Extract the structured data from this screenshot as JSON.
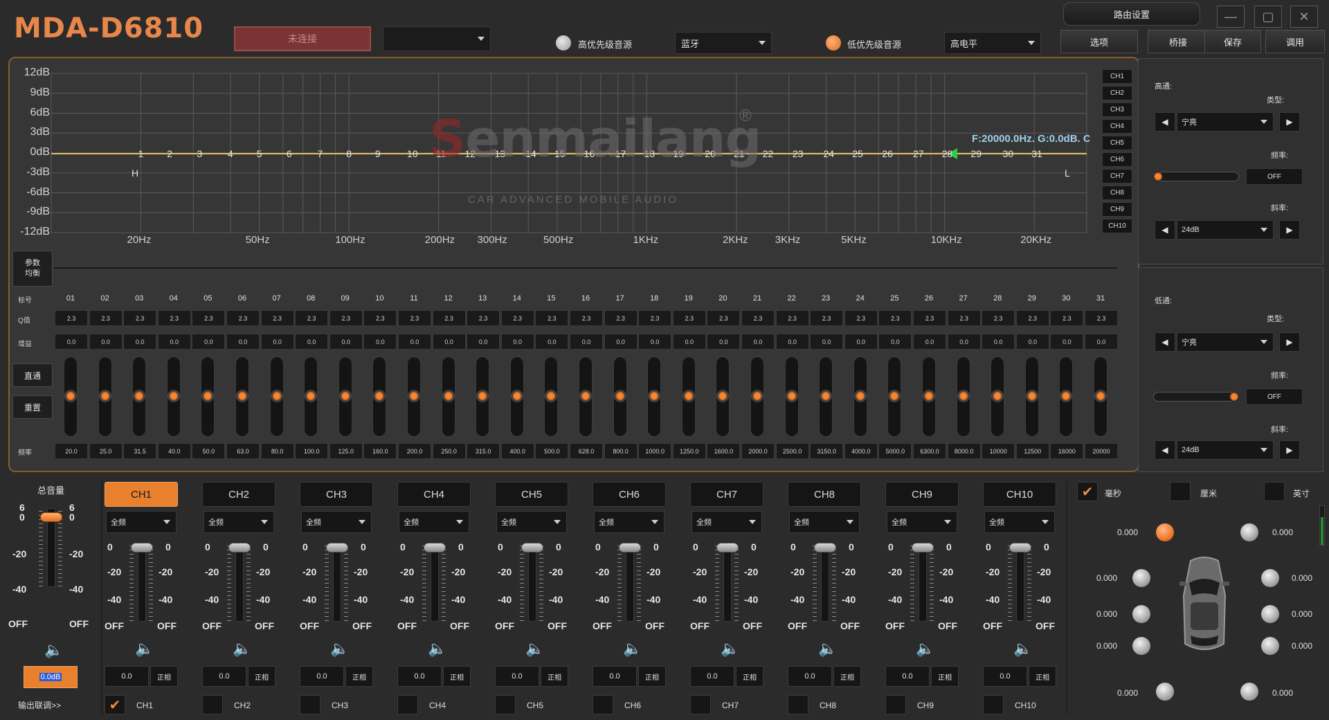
{
  "header": {
    "logo": "MDA-D6810",
    "connect_label": "未连接",
    "device_select": "",
    "high_priority_label": "高优先级音源",
    "high_priority_source": "蓝牙",
    "low_priority_label": "低优先级音源",
    "low_priority_source": "高电平",
    "routing_label": "路由设置",
    "buttons": [
      "选项",
      "桥接",
      "保存",
      "调用"
    ],
    "window_controls": {
      "minimize": "—",
      "maximize": "▢",
      "close": "✕"
    }
  },
  "eq": {
    "y_ticks": [
      "12dB",
      "9dB",
      "6dB",
      "3dB",
      "0dB",
      "-3dB",
      "-6dB",
      "-9dB",
      "-12dB"
    ],
    "x_ticks": [
      "20Hz",
      "50Hz",
      "100Hz",
      "200Hz",
      "300Hz",
      "500Hz",
      "1KHz",
      "2KHz",
      "3KHz",
      "5KHz",
      "10KHz",
      "20KHz"
    ],
    "band_markers": [
      "1",
      "2",
      "3",
      "4",
      "5",
      "6",
      "7",
      "8",
      "9",
      "10",
      "11",
      "12",
      "13",
      "14",
      "15",
      "16",
      "17",
      "18",
      "19",
      "20",
      "21",
      "22",
      "23",
      "24",
      "25",
      "26",
      "27",
      "28",
      "29",
      "30",
      "31"
    ],
    "hp_marker": "H",
    "lp_marker": "L",
    "readout": "F:20000.0Hz. G:0.0dB. C",
    "watermark": {
      "brand": "enmailang",
      "brand_s": "S",
      "tagline": "CAR ADVANCED MOBILE AUDIO",
      "reg": "®"
    },
    "channel_tabs": [
      "CH1",
      "CH2",
      "CH3",
      "CH4",
      "CH5",
      "CH6",
      "CH7",
      "CH8",
      "CH9",
      "CH10"
    ],
    "peq_label_1": "参数",
    "peq_label_2": "均衡",
    "row_labels": {
      "band": "标号",
      "q": "Q值",
      "gain": "增益",
      "freq": "频率"
    },
    "bypass_label": "直通",
    "reset_label": "重置",
    "bands": [
      {
        "no": "01",
        "q": "2.3",
        "gain": "0.0",
        "freq": "20.0"
      },
      {
        "no": "02",
        "q": "2.3",
        "gain": "0.0",
        "freq": "25.0"
      },
      {
        "no": "03",
        "q": "2.3",
        "gain": "0.0",
        "freq": "31.5"
      },
      {
        "no": "04",
        "q": "2.3",
        "gain": "0.0",
        "freq": "40.0"
      },
      {
        "no": "05",
        "q": "2.3",
        "gain": "0.0",
        "freq": "50.0"
      },
      {
        "no": "06",
        "q": "2.3",
        "gain": "0.0",
        "freq": "63.0"
      },
      {
        "no": "07",
        "q": "2.3",
        "gain": "0.0",
        "freq": "80.0"
      },
      {
        "no": "08",
        "q": "2.3",
        "gain": "0.0",
        "freq": "100.0"
      },
      {
        "no": "09",
        "q": "2.3",
        "gain": "0.0",
        "freq": "125.0"
      },
      {
        "no": "10",
        "q": "2.3",
        "gain": "0.0",
        "freq": "160.0"
      },
      {
        "no": "11",
        "q": "2.3",
        "gain": "0.0",
        "freq": "200.0"
      },
      {
        "no": "12",
        "q": "2.3",
        "gain": "0.0",
        "freq": "250.0"
      },
      {
        "no": "13",
        "q": "2.3",
        "gain": "0.0",
        "freq": "315.0"
      },
      {
        "no": "14",
        "q": "2.3",
        "gain": "0.0",
        "freq": "400.0"
      },
      {
        "no": "15",
        "q": "2.3",
        "gain": "0.0",
        "freq": "500.0"
      },
      {
        "no": "16",
        "q": "2.3",
        "gain": "0.0",
        "freq": "628.0"
      },
      {
        "no": "17",
        "q": "2.3",
        "gain": "0.0",
        "freq": "800.0"
      },
      {
        "no": "18",
        "q": "2.3",
        "gain": "0.0",
        "freq": "1000.0"
      },
      {
        "no": "19",
        "q": "2.3",
        "gain": "0.0",
        "freq": "1250.0"
      },
      {
        "no": "20",
        "q": "2.3",
        "gain": "0.0",
        "freq": "1600.0"
      },
      {
        "no": "21",
        "q": "2.3",
        "gain": "0.0",
        "freq": "2000.0"
      },
      {
        "no": "22",
        "q": "2.3",
        "gain": "0.0",
        "freq": "2500.0"
      },
      {
        "no": "23",
        "q": "2.3",
        "gain": "0.0",
        "freq": "3150.0"
      },
      {
        "no": "24",
        "q": "2.3",
        "gain": "0.0",
        "freq": "4000.0"
      },
      {
        "no": "25",
        "q": "2.3",
        "gain": "0.0",
        "freq": "5000.0"
      },
      {
        "no": "26",
        "q": "2.3",
        "gain": "0.0",
        "freq": "6300.0"
      },
      {
        "no": "27",
        "q": "2.3",
        "gain": "0.0",
        "freq": "8000.0"
      },
      {
        "no": "28",
        "q": "2.3",
        "gain": "0.0",
        "freq": "10000"
      },
      {
        "no": "29",
        "q": "2.3",
        "gain": "0.0",
        "freq": "12500"
      },
      {
        "no": "30",
        "q": "2.3",
        "gain": "0.0",
        "freq": "16000"
      },
      {
        "no": "31",
        "q": "2.3",
        "gain": "0.0",
        "freq": "20000"
      }
    ]
  },
  "highpass": {
    "title": "高通:",
    "type_label": "类型:",
    "type": "宁亮",
    "freq_label": "频率:",
    "freq": "OFF",
    "slope_label": "斜率:",
    "slope": "24dB"
  },
  "lowpass": {
    "title": "低通:",
    "type_label": "类型:",
    "type": "宁亮",
    "freq_label": "频率:",
    "freq": "OFF",
    "slope_label": "斜率:",
    "slope": "24dB"
  },
  "master": {
    "title": "总音量",
    "scale_left": [
      "6",
      "0",
      "-20",
      "-40",
      "OFF"
    ],
    "scale_right": [
      "6",
      "0",
      "-20",
      "-40",
      "OFF"
    ],
    "value": "0.0dB",
    "link_label": "输出联调>>"
  },
  "channels": [
    {
      "name": "CH1",
      "mode": "全频",
      "gain": "0.0",
      "phase": "正相",
      "link": "CH1",
      "checked": true
    },
    {
      "name": "CH2",
      "mode": "全频",
      "gain": "0.0",
      "phase": "正相",
      "link": "CH2",
      "checked": false
    },
    {
      "name": "CH3",
      "mode": "全频",
      "gain": "0.0",
      "phase": "正相",
      "link": "CH3",
      "checked": false
    },
    {
      "name": "CH4",
      "mode": "全频",
      "gain": "0.0",
      "phase": "正相",
      "link": "CH4",
      "checked": false
    },
    {
      "name": "CH5",
      "mode": "全频",
      "gain": "0.0",
      "phase": "正相",
      "link": "CH5",
      "checked": false
    },
    {
      "name": "CH6",
      "mode": "全频",
      "gain": "0.0",
      "phase": "正相",
      "link": "CH6",
      "checked": false
    },
    {
      "name": "CH7",
      "mode": "全频",
      "gain": "0.0",
      "phase": "正相",
      "link": "CH7",
      "checked": false
    },
    {
      "name": "CH8",
      "mode": "全频",
      "gain": "0.0",
      "phase": "正相",
      "link": "CH8",
      "checked": false
    },
    {
      "name": "CH9",
      "mode": "全频",
      "gain": "0.0",
      "phase": "正相",
      "link": "CH9",
      "checked": false
    },
    {
      "name": "CH10",
      "mode": "全频",
      "gain": "0.0",
      "phase": "正相",
      "link": "CH10",
      "checked": false
    }
  ],
  "channel_scale": [
    "0",
    "-20",
    "-40",
    "OFF"
  ],
  "delay": {
    "units": [
      {
        "label": "毫秒",
        "checked": true
      },
      {
        "label": "厘米",
        "checked": false
      },
      {
        "label": "英寸",
        "checked": false
      }
    ],
    "values": [
      "0.000",
      "0.000",
      "0.000",
      "0.000",
      "0.000",
      "0.000",
      "0.000",
      "0.000",
      "0.000",
      "0.000"
    ]
  }
}
